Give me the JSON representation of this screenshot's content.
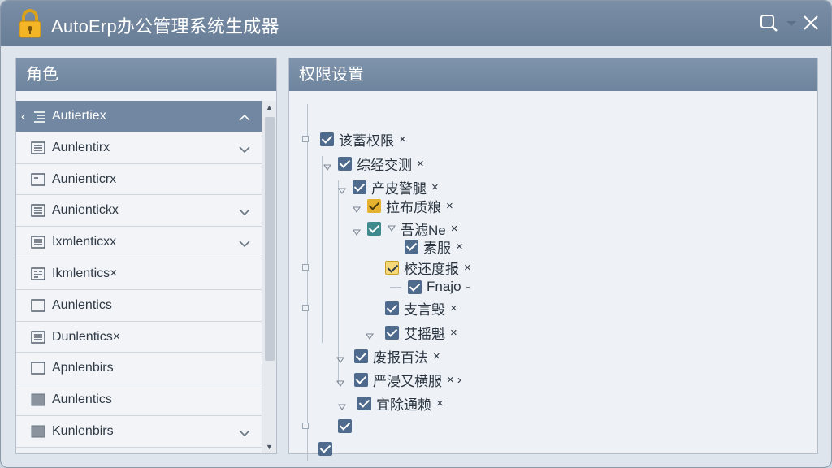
{
  "window": {
    "title": "AutoErp办公管理系统生成器"
  },
  "left_panel": {
    "header": "角色",
    "items": [
      {
        "label": "Autiertiex",
        "icon": "list-icon",
        "selected": true,
        "chevron": "up"
      },
      {
        "label": "Aunlentirx",
        "icon": "list-icon",
        "chevron": "down"
      },
      {
        "label": "Aunienticrx",
        "icon": "card-icon",
        "chevron": ""
      },
      {
        "label": "Aunientickx",
        "icon": "list-icon",
        "chevron": "down"
      },
      {
        "label": "Ixmlenticxx",
        "icon": "list-icon",
        "chevron": "down"
      },
      {
        "label": "Ikmlentics×",
        "icon": "grid-icon",
        "chevron": ""
      },
      {
        "label": "Aunlentics",
        "icon": "empty-box-icon",
        "chevron": ""
      },
      {
        "label": "Dunlentics×",
        "icon": "list-icon",
        "chevron": ""
      },
      {
        "label": "Apnlenbirs",
        "icon": "empty-box-icon",
        "chevron": ""
      },
      {
        "label": "Aunlentics",
        "icon": "filled-box-icon",
        "chevron": ""
      },
      {
        "label": "Kunlenbirs",
        "icon": "filled-box-icon",
        "chevron": "down"
      }
    ]
  },
  "right_panel": {
    "header": "权限设置",
    "tree": [
      {
        "label": "该蓄权限",
        "x_mark": "×"
      },
      {
        "label": "综经交测",
        "x_mark": "×"
      },
      {
        "label": "产皮警腿",
        "x_mark": "×"
      },
      {
        "label": "拉布质粮",
        "x_mark": "×"
      },
      {
        "label": "吾滤Ne",
        "x_mark": "×"
      },
      {
        "label": "素服",
        "x_mark": "×"
      },
      {
        "label": "校还度报",
        "x_mark": "×"
      },
      {
        "label": "Fnajo",
        "x_mark": "-"
      },
      {
        "label": "支言毁",
        "x_mark": "×"
      },
      {
        "label": "艾摇魁",
        "x_mark": "×"
      },
      {
        "label": "废报百法",
        "x_mark": "×"
      },
      {
        "label": "严浸又横服",
        "x_mark": "× ›"
      },
      {
        "label": "宜除通赖",
        "x_mark": "×"
      },
      {
        "label": "",
        "x_mark": ""
      },
      {
        "label": "",
        "x_mark": ""
      }
    ]
  },
  "colors": {
    "titlebar": "#6e849d",
    "checkbox": "#4e6a8c",
    "partial": "#e4b22e",
    "selected_row": "#7288a2"
  }
}
